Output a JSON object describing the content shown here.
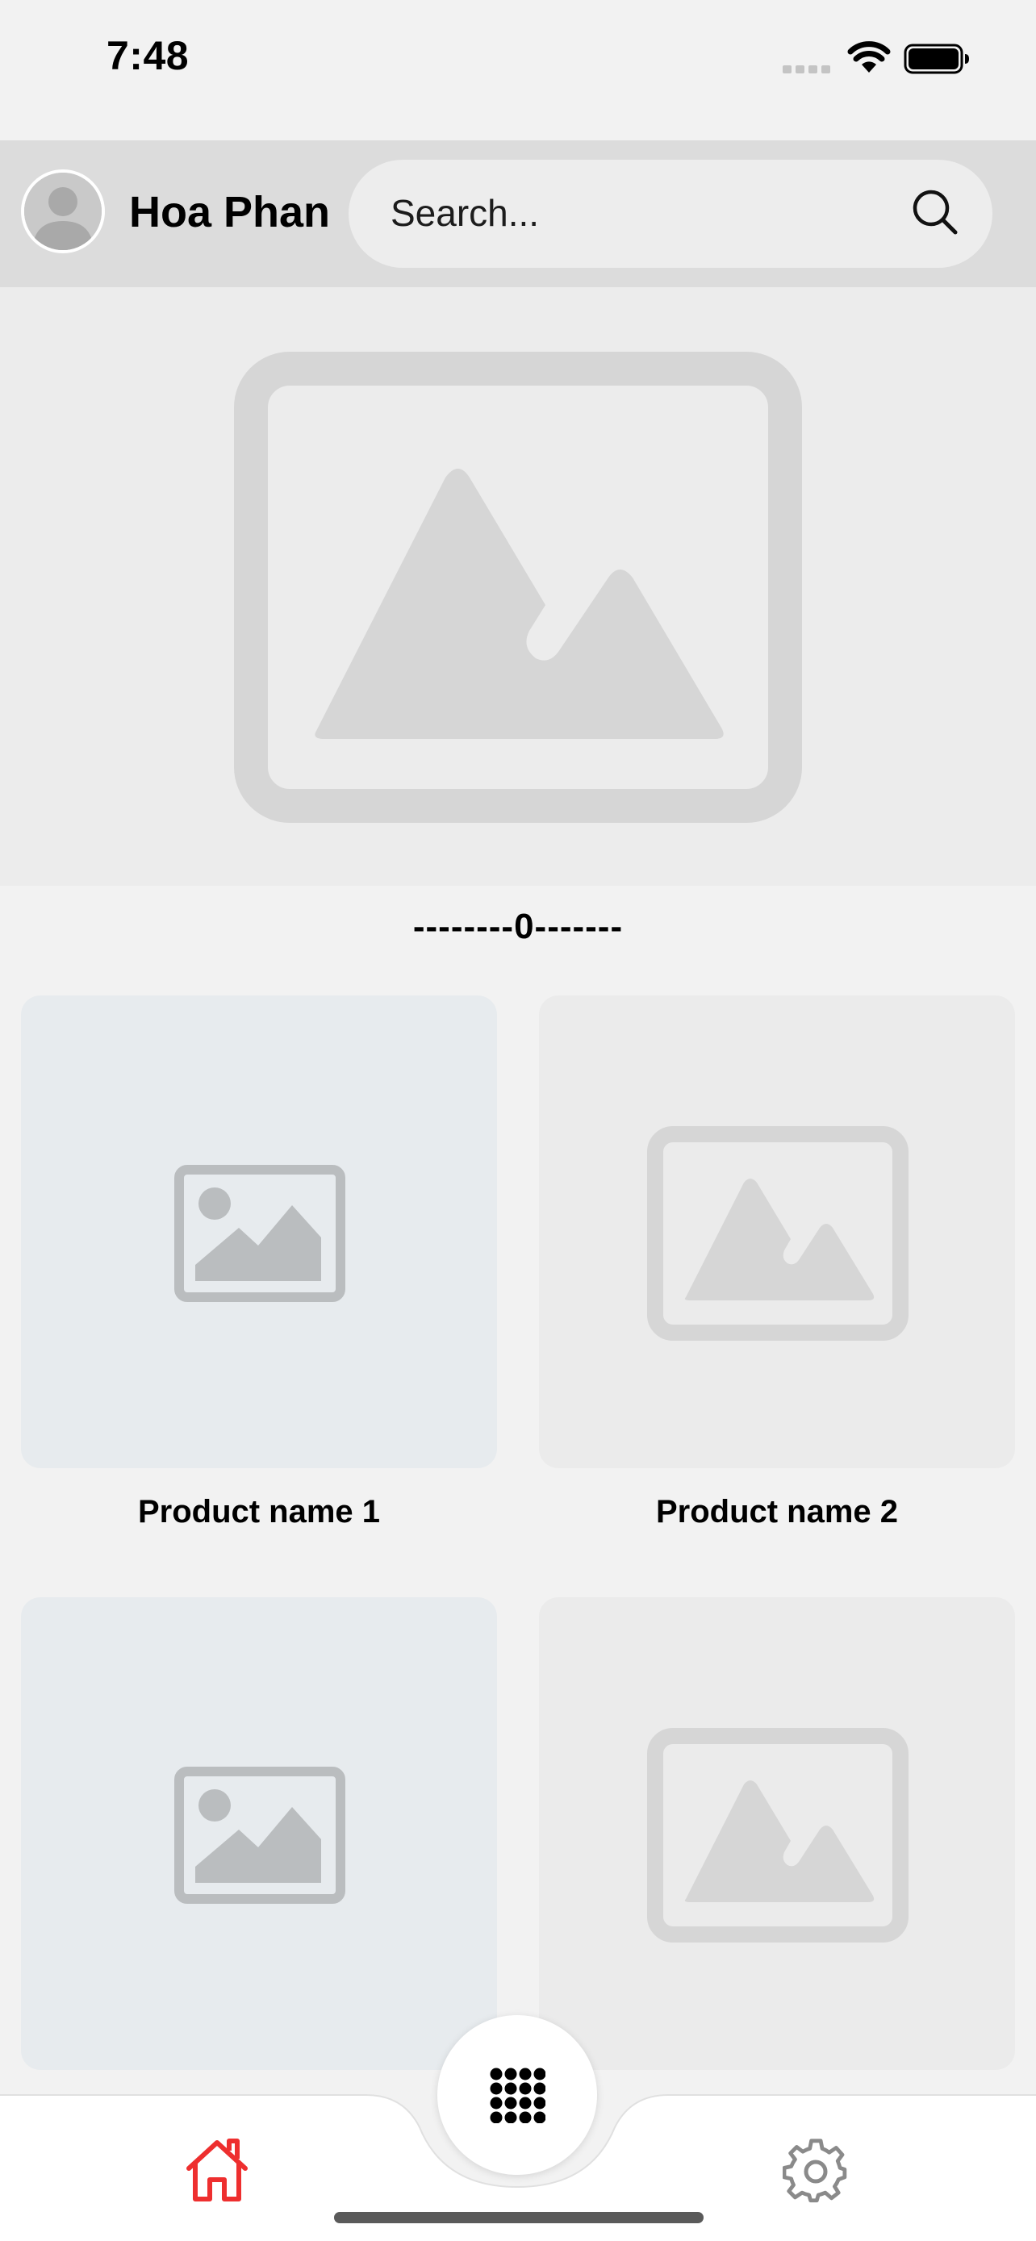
{
  "status_bar": {
    "time": "7:48"
  },
  "header": {
    "user_name": "Hoa Phan",
    "search": {
      "placeholder": "Search...",
      "value": ""
    }
  },
  "counter": "--------0-------",
  "products": [
    {
      "name": "Product name 1"
    },
    {
      "name": "Product name 2"
    },
    {
      "name": ""
    },
    {
      "name": ""
    }
  ],
  "tab_bar": {
    "items": [
      {
        "icon": "home-icon",
        "active": true
      },
      {
        "icon": "grid-menu-icon",
        "active": false
      },
      {
        "icon": "gear-icon",
        "active": false
      }
    ]
  },
  "colors": {
    "accent": "#ee2f2f",
    "header_bg": "#dcdcdc",
    "page_bg": "#f2f2f2",
    "placeholder_gray": "#d4d4d4"
  }
}
